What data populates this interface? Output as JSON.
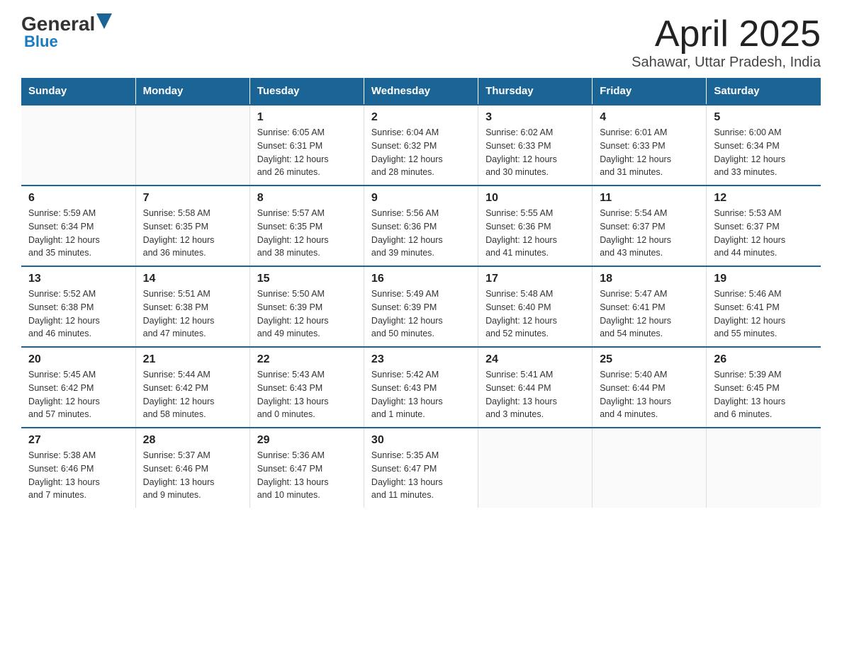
{
  "logo": {
    "general": "General",
    "blue": "Blue"
  },
  "title": "April 2025",
  "subtitle": "Sahawar, Uttar Pradesh, India",
  "days_of_week": [
    "Sunday",
    "Monday",
    "Tuesday",
    "Wednesday",
    "Thursday",
    "Friday",
    "Saturday"
  ],
  "weeks": [
    [
      {
        "day": "",
        "info": ""
      },
      {
        "day": "",
        "info": ""
      },
      {
        "day": "1",
        "info": "Sunrise: 6:05 AM\nSunset: 6:31 PM\nDaylight: 12 hours\nand 26 minutes."
      },
      {
        "day": "2",
        "info": "Sunrise: 6:04 AM\nSunset: 6:32 PM\nDaylight: 12 hours\nand 28 minutes."
      },
      {
        "day": "3",
        "info": "Sunrise: 6:02 AM\nSunset: 6:33 PM\nDaylight: 12 hours\nand 30 minutes."
      },
      {
        "day": "4",
        "info": "Sunrise: 6:01 AM\nSunset: 6:33 PM\nDaylight: 12 hours\nand 31 minutes."
      },
      {
        "day": "5",
        "info": "Sunrise: 6:00 AM\nSunset: 6:34 PM\nDaylight: 12 hours\nand 33 minutes."
      }
    ],
    [
      {
        "day": "6",
        "info": "Sunrise: 5:59 AM\nSunset: 6:34 PM\nDaylight: 12 hours\nand 35 minutes."
      },
      {
        "day": "7",
        "info": "Sunrise: 5:58 AM\nSunset: 6:35 PM\nDaylight: 12 hours\nand 36 minutes."
      },
      {
        "day": "8",
        "info": "Sunrise: 5:57 AM\nSunset: 6:35 PM\nDaylight: 12 hours\nand 38 minutes."
      },
      {
        "day": "9",
        "info": "Sunrise: 5:56 AM\nSunset: 6:36 PM\nDaylight: 12 hours\nand 39 minutes."
      },
      {
        "day": "10",
        "info": "Sunrise: 5:55 AM\nSunset: 6:36 PM\nDaylight: 12 hours\nand 41 minutes."
      },
      {
        "day": "11",
        "info": "Sunrise: 5:54 AM\nSunset: 6:37 PM\nDaylight: 12 hours\nand 43 minutes."
      },
      {
        "day": "12",
        "info": "Sunrise: 5:53 AM\nSunset: 6:37 PM\nDaylight: 12 hours\nand 44 minutes."
      }
    ],
    [
      {
        "day": "13",
        "info": "Sunrise: 5:52 AM\nSunset: 6:38 PM\nDaylight: 12 hours\nand 46 minutes."
      },
      {
        "day": "14",
        "info": "Sunrise: 5:51 AM\nSunset: 6:38 PM\nDaylight: 12 hours\nand 47 minutes."
      },
      {
        "day": "15",
        "info": "Sunrise: 5:50 AM\nSunset: 6:39 PM\nDaylight: 12 hours\nand 49 minutes."
      },
      {
        "day": "16",
        "info": "Sunrise: 5:49 AM\nSunset: 6:39 PM\nDaylight: 12 hours\nand 50 minutes."
      },
      {
        "day": "17",
        "info": "Sunrise: 5:48 AM\nSunset: 6:40 PM\nDaylight: 12 hours\nand 52 minutes."
      },
      {
        "day": "18",
        "info": "Sunrise: 5:47 AM\nSunset: 6:41 PM\nDaylight: 12 hours\nand 54 minutes."
      },
      {
        "day": "19",
        "info": "Sunrise: 5:46 AM\nSunset: 6:41 PM\nDaylight: 12 hours\nand 55 minutes."
      }
    ],
    [
      {
        "day": "20",
        "info": "Sunrise: 5:45 AM\nSunset: 6:42 PM\nDaylight: 12 hours\nand 57 minutes."
      },
      {
        "day": "21",
        "info": "Sunrise: 5:44 AM\nSunset: 6:42 PM\nDaylight: 12 hours\nand 58 minutes."
      },
      {
        "day": "22",
        "info": "Sunrise: 5:43 AM\nSunset: 6:43 PM\nDaylight: 13 hours\nand 0 minutes."
      },
      {
        "day": "23",
        "info": "Sunrise: 5:42 AM\nSunset: 6:43 PM\nDaylight: 13 hours\nand 1 minute."
      },
      {
        "day": "24",
        "info": "Sunrise: 5:41 AM\nSunset: 6:44 PM\nDaylight: 13 hours\nand 3 minutes."
      },
      {
        "day": "25",
        "info": "Sunrise: 5:40 AM\nSunset: 6:44 PM\nDaylight: 13 hours\nand 4 minutes."
      },
      {
        "day": "26",
        "info": "Sunrise: 5:39 AM\nSunset: 6:45 PM\nDaylight: 13 hours\nand 6 minutes."
      }
    ],
    [
      {
        "day": "27",
        "info": "Sunrise: 5:38 AM\nSunset: 6:46 PM\nDaylight: 13 hours\nand 7 minutes."
      },
      {
        "day": "28",
        "info": "Sunrise: 5:37 AM\nSunset: 6:46 PM\nDaylight: 13 hours\nand 9 minutes."
      },
      {
        "day": "29",
        "info": "Sunrise: 5:36 AM\nSunset: 6:47 PM\nDaylight: 13 hours\nand 10 minutes."
      },
      {
        "day": "30",
        "info": "Sunrise: 5:35 AM\nSunset: 6:47 PM\nDaylight: 13 hours\nand 11 minutes."
      },
      {
        "day": "",
        "info": ""
      },
      {
        "day": "",
        "info": ""
      },
      {
        "day": "",
        "info": ""
      }
    ]
  ]
}
